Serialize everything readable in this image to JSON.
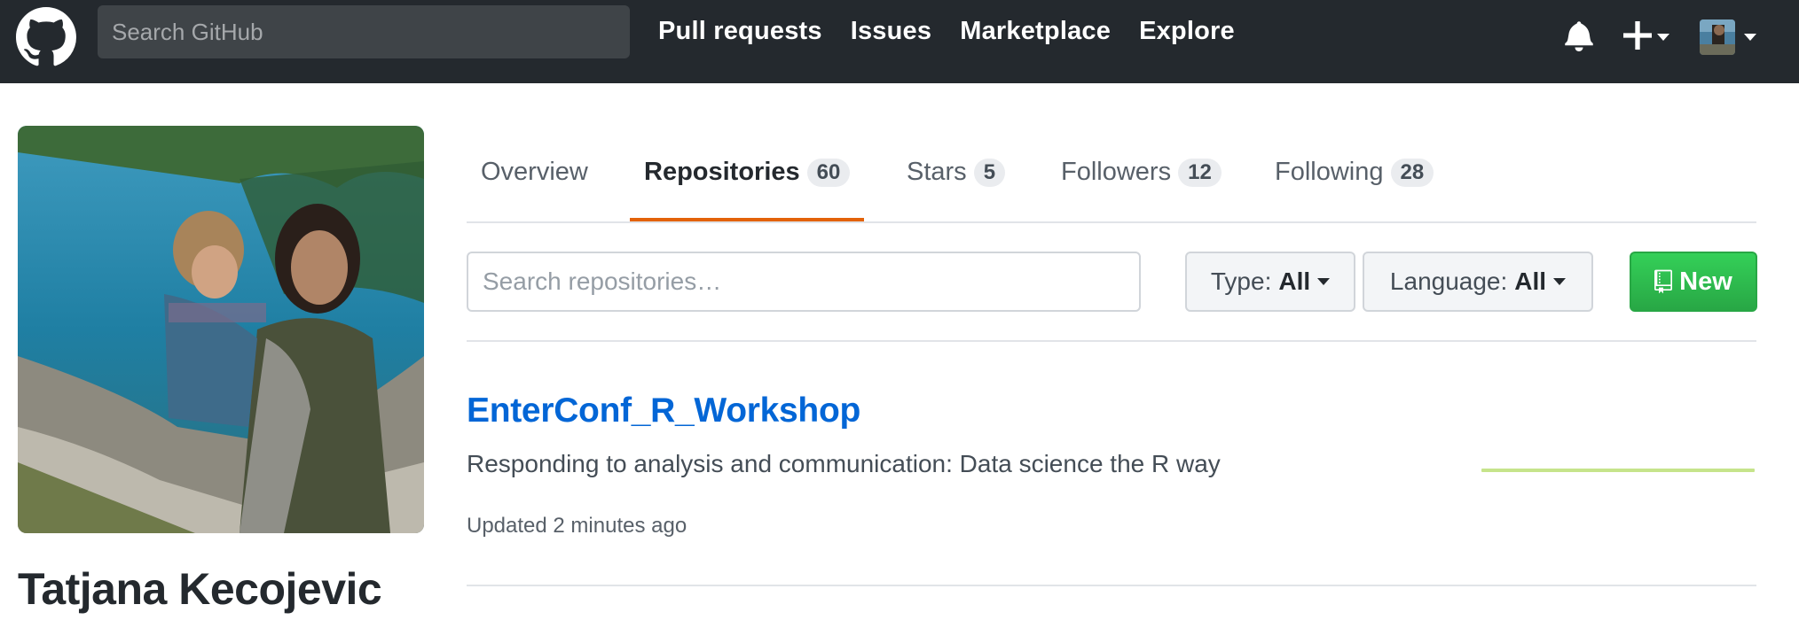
{
  "header": {
    "search_placeholder": "Search GitHub",
    "nav": [
      "Pull requests",
      "Issues",
      "Marketplace",
      "Explore"
    ]
  },
  "profile": {
    "name": "Tatjana Kecojevic"
  },
  "tabs": [
    {
      "label": "Overview",
      "count": null
    },
    {
      "label": "Repositories",
      "count": "60",
      "active": true
    },
    {
      "label": "Stars",
      "count": "5"
    },
    {
      "label": "Followers",
      "count": "12"
    },
    {
      "label": "Following",
      "count": "28"
    }
  ],
  "filters": {
    "search_placeholder": "Search repositories…",
    "type_label": "Type:",
    "type_value": "All",
    "language_label": "Language:",
    "language_value": "All",
    "new_label": "New"
  },
  "repos": [
    {
      "name": "EnterConf_R_Workshop",
      "description": "Responding to analysis and communication: Data science the R way",
      "updated": "Updated 2 minutes ago"
    }
  ],
  "colors": {
    "header_bg": "#24292e",
    "link": "#0366d6",
    "tab_underline": "#e36209",
    "new_button": "#2ea44f",
    "sparkline": "#c6e48b"
  },
  "icons": [
    "github-logo-icon",
    "bell-icon",
    "plus-icon",
    "repo-icon"
  ]
}
